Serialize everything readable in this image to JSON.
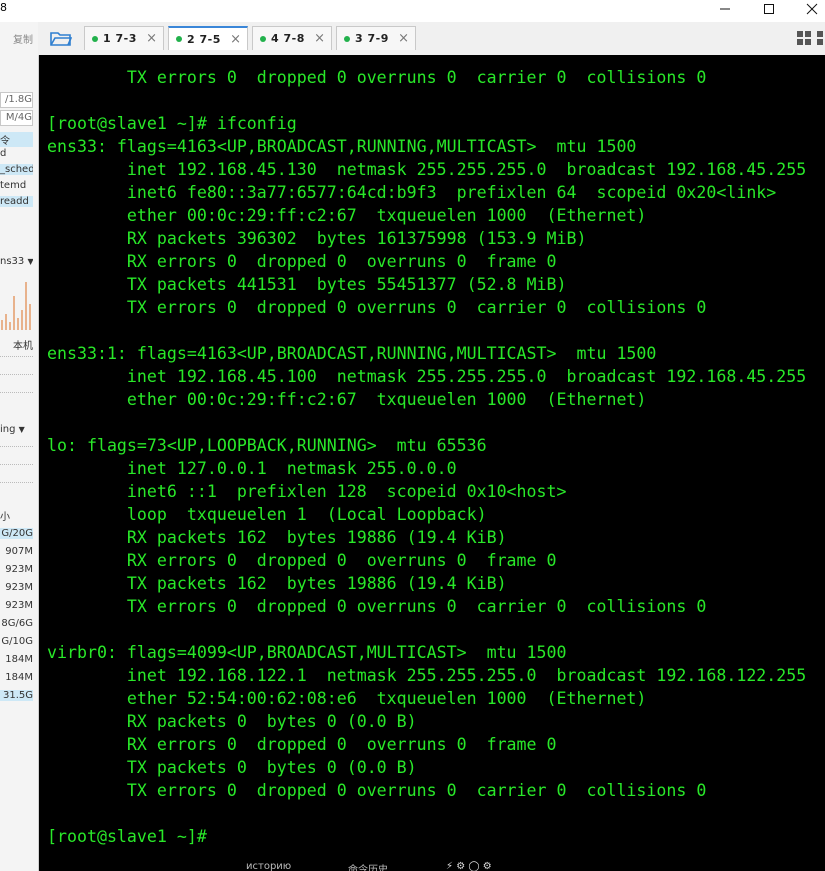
{
  "window": {
    "title_fragment": "8"
  },
  "tabs": [
    {
      "label": "1 7-3",
      "active": false
    },
    {
      "label": "2 7-5",
      "active": true
    },
    {
      "label": "4 7-8",
      "active": false
    },
    {
      "label": "3 7-9",
      "active": false
    }
  ],
  "left_panel": {
    "copy": "复制",
    "mem1": "/1.8G",
    "mem2": "M/4G",
    "proc_header": "令",
    "procs": [
      "d",
      "_sched",
      "temd",
      "readd"
    ],
    "net_iface": "ns33",
    "local": "本机",
    "ping": "ing",
    "size_header": "小",
    "disks": [
      "G/20G",
      "907M",
      "923M",
      "923M",
      "923M",
      "8G/6G",
      "G/10G",
      "184M",
      "184M",
      "31.5G"
    ]
  },
  "terminal": {
    "prompt_color": "#29e829",
    "lines": [
      "        TX errors 0  dropped 0 overruns 0  carrier 0  collisions 0",
      "",
      "[root@slave1 ~]# ifconfig",
      "ens33: flags=4163<UP,BROADCAST,RUNNING,MULTICAST>  mtu 1500",
      "        inet 192.168.45.130  netmask 255.255.255.0  broadcast 192.168.45.255",
      "        inet6 fe80::3a77:6577:64cd:b9f3  prefixlen 64  scopeid 0x20<link>",
      "        ether 00:0c:29:ff:c2:67  txqueuelen 1000  (Ethernet)",
      "        RX packets 396302  bytes 161375998 (153.9 MiB)",
      "        RX errors 0  dropped 0  overruns 0  frame 0",
      "        TX packets 441531  bytes 55451377 (52.8 MiB)",
      "        TX errors 0  dropped 0 overruns 0  carrier 0  collisions 0",
      "",
      "ens33:1: flags=4163<UP,BROADCAST,RUNNING,MULTICAST>  mtu 1500",
      "        inet 192.168.45.100  netmask 255.255.255.0  broadcast 192.168.45.255",
      "        ether 00:0c:29:ff:c2:67  txqueuelen 1000  (Ethernet)",
      "",
      "lo: flags=73<UP,LOOPBACK,RUNNING>  mtu 65536",
      "        inet 127.0.0.1  netmask 255.0.0.0",
      "        inet6 ::1  prefixlen 128  scopeid 0x10<host>",
      "        loop  txqueuelen 1  (Local Loopback)",
      "        RX packets 162  bytes 19886 (19.4 KiB)",
      "        RX errors 0  dropped 0  overruns 0  frame 0",
      "        TX packets 162  bytes 19886 (19.4 KiB)",
      "        TX errors 0  dropped 0 overruns 0  carrier 0  collisions 0",
      "",
      "virbr0: flags=4099<UP,BROADCAST,MULTICAST>  mtu 1500",
      "        inet 192.168.122.1  netmask 255.255.255.0  broadcast 192.168.122.255",
      "        ether 52:54:00:62:08:e6  txqueuelen 1000  (Ethernet)",
      "        RX packets 0  bytes 0 (0.0 B)",
      "        RX errors 0  dropped 0  overruns 0  frame 0",
      "        TX packets 0  bytes 0 (0.0 B)",
      "        TX errors 0  dropped 0 overruns 0  carrier 0  collisions 0",
      "",
      "[root@slave1 ~]#"
    ]
  },
  "bottom_bar": {
    "history": "историю",
    "cmd": "命令历史"
  }
}
